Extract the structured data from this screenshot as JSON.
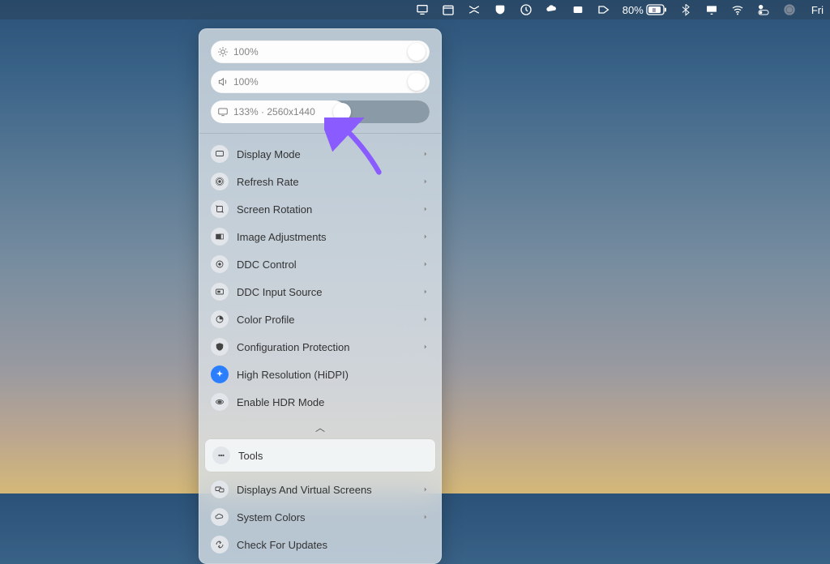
{
  "menubar": {
    "battery_text": "80%",
    "day_text": "Fri"
  },
  "panel": {
    "brightness": {
      "value_text": "100%"
    },
    "volume": {
      "value_text": "100%"
    },
    "resolution": {
      "value_text": "133% · 2560x1440"
    },
    "items": [
      {
        "label": "Display Mode",
        "has_chevron": true
      },
      {
        "label": "Refresh Rate",
        "has_chevron": true
      },
      {
        "label": "Screen Rotation",
        "has_chevron": true
      },
      {
        "label": "Image Adjustments",
        "has_chevron": true
      },
      {
        "label": "DDC Control",
        "has_chevron": true
      },
      {
        "label": "DDC Input Source",
        "has_chevron": true
      },
      {
        "label": "Color Profile",
        "has_chevron": true
      },
      {
        "label": "Configuration Protection",
        "has_chevron": true
      },
      {
        "label": "High Resolution (HiDPI)",
        "has_chevron": false
      },
      {
        "label": "Enable HDR Mode",
        "has_chevron": false
      }
    ],
    "tools_label": "Tools",
    "secondary_items": [
      {
        "label": "Displays And Virtual Screens",
        "has_chevron": true
      },
      {
        "label": "System Colors",
        "has_chevron": true
      },
      {
        "label": "Check For Updates",
        "has_chevron": false
      }
    ]
  }
}
